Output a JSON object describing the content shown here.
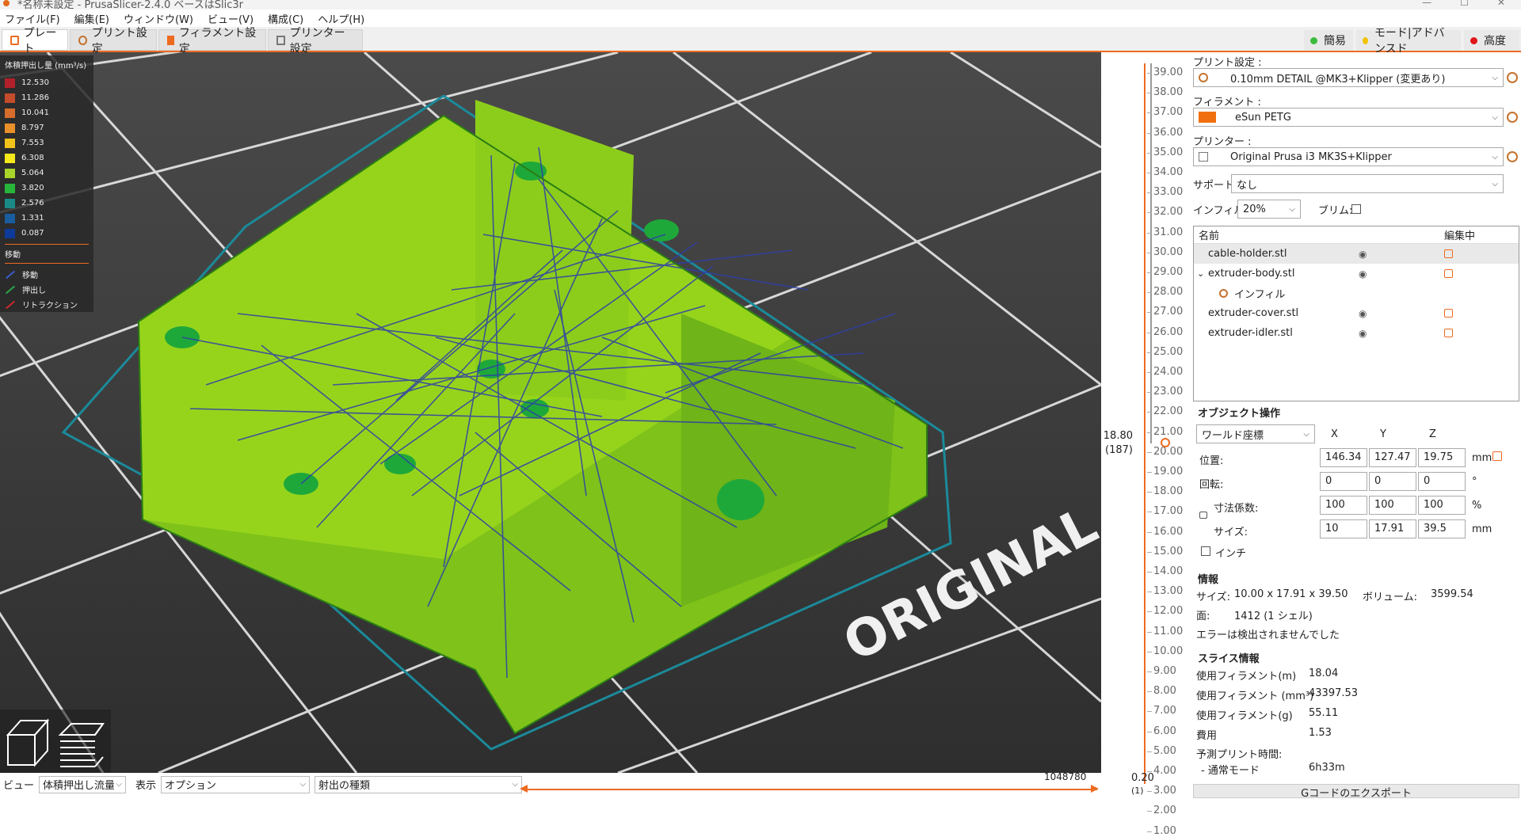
{
  "window": {
    "title": "*名称未設定 - PrusaSlicer-2.4.0 ベースはSlic3r",
    "minimize": "—",
    "maximize": "☐",
    "close": "✕"
  },
  "menu": [
    "ファイル(F)",
    "編集(E)",
    "ウィンドウ(W)",
    "ビュー(V)",
    "構成(C)",
    "ヘルプ(H)"
  ],
  "tabs": [
    {
      "label": "プレート",
      "active": true
    },
    {
      "label": "プリント設定",
      "active": false
    },
    {
      "label": "フィラメント設定",
      "active": false
    },
    {
      "label": "プリンター設定",
      "active": false
    }
  ],
  "modes": [
    {
      "label": "簡易",
      "color": "#3dbb3d"
    },
    {
      "label": "モード|アドバンスド",
      "color": "#f2c300"
    },
    {
      "label": "高度",
      "color": "#e0151b"
    }
  ],
  "legend": {
    "title": "体積押出し量 (mm³/s)",
    "entries": [
      {
        "value": "12.530",
        "color": "#b2202b"
      },
      {
        "value": "11.286",
        "color": "#c44b2c"
      },
      {
        "value": "10.041",
        "color": "#d66d2c"
      },
      {
        "value": "8.797",
        "color": "#e9902b"
      },
      {
        "value": "7.553",
        "color": "#f2c21c"
      },
      {
        "value": "6.308",
        "color": "#f7e81c"
      },
      {
        "value": "5.064",
        "color": "#a8d52a"
      },
      {
        "value": "3.820",
        "color": "#27b53a"
      },
      {
        "value": "2.576",
        "color": "#1b8a86"
      },
      {
        "value": "1.331",
        "color": "#1a5d9e"
      },
      {
        "value": "0.087",
        "color": "#0e3a99"
      }
    ],
    "moves_title": "移動",
    "moves": [
      {
        "label": "移動",
        "color": "#3a5ccc"
      },
      {
        "label": "押出し",
        "color": "#2aa84a"
      },
      {
        "label": "リトラクション",
        "color": "#cc2a2a"
      }
    ]
  },
  "bed_text": "ORIGINAL P",
  "bottom": {
    "view_label": "ビュー",
    "view_value": "体積押出し流量",
    "show_label": "表示",
    "show_value": "オプション",
    "type_value": "射出の種類",
    "h_slider_value": "1048780"
  },
  "vertical_slider": {
    "ticks": [
      "39.00",
      "38.00",
      "37.00",
      "36.00",
      "35.00",
      "34.00",
      "33.00",
      "32.00",
      "31.00",
      "30.00",
      "29.00",
      "28.00",
      "27.00",
      "26.00",
      "25.00",
      "24.00",
      "23.00",
      "22.00",
      "21.00",
      "20.00",
      "19.00",
      "18.00",
      "17.00",
      "16.00",
      "15.00",
      "14.00",
      "13.00",
      "12.00",
      "11.00",
      "10.00",
      "9.00",
      "8.00",
      "7.00",
      "6.00",
      "5.00",
      "4.00",
      "3.00",
      "2.00",
      "1.00"
    ],
    "current_height": "18.80",
    "current_layer": "(187)",
    "bottom_height": "0.20",
    "bottom_layer": "(1)"
  },
  "panel": {
    "print_label": "プリント設定 :",
    "print_value": "0.10mm DETAIL @MK3+Klipper (変更あり)",
    "filament_label": "フィラメント :",
    "filament_value": "eSun PETG",
    "filament_color": "#f07010",
    "printer_label": "プリンター :",
    "printer_value": "Original Prusa i3 MK3S+Klipper",
    "support_label": "サポート:",
    "support_value": "なし",
    "infill_label": "インフィル:",
    "infill_value": "20%",
    "brim_label": "ブリム:",
    "list_col_name": "名前",
    "list_col_edit": "編集中",
    "objects": [
      {
        "name": "cable-holder.stl",
        "selected": true,
        "expander": "",
        "indent": false
      },
      {
        "name": "extruder-body.stl",
        "selected": false,
        "expander": "⌄",
        "indent": false
      },
      {
        "name": "インフィル",
        "selected": false,
        "expander": "",
        "indent": true
      },
      {
        "name": "extruder-cover.stl",
        "selected": false,
        "expander": "",
        "indent": false
      },
      {
        "name": "extruder-idler.stl",
        "selected": false,
        "expander": "",
        "indent": false
      }
    ],
    "eye_glyph": "👁",
    "obj_ops_title": "オブジェクト操作",
    "coord_value": "ワールド座標",
    "axis_x": "X",
    "axis_y": "Y",
    "axis_z": "Z",
    "position_label": "位置:",
    "position": [
      "146.34",
      "127.47",
      "19.75"
    ],
    "position_unit": "mm",
    "rotation_label": "回転:",
    "rotation": [
      "0",
      "0",
      "0"
    ],
    "rotation_unit": "°",
    "scale_label": "寸法係数:",
    "scale": [
      "100",
      "100",
      "100"
    ],
    "scale_unit": "%",
    "size_label": "サイズ:",
    "size": [
      "10",
      "17.91",
      "39.5"
    ],
    "size_unit": "mm",
    "inch_label": "インチ",
    "info_title": "情報",
    "info_size_label": "サイズ:",
    "info_size_value": "10.00 x 17.91 x 39.50",
    "info_volume_label": "ボリューム:",
    "info_volume_value": "3599.54",
    "info_faces_label": "面:",
    "info_faces_value": "1412 (1 シェル)",
    "info_errors": "エラーは検出されませんでした",
    "slice_title": "スライス情報",
    "slice_rows": [
      {
        "label": "使用フィラメント(m)",
        "value": "18.04"
      },
      {
        "label": "使用フィラメント (mm³)",
        "value": "43397.53"
      },
      {
        "label": "使用フィラメント(g)",
        "value": "55.11"
      },
      {
        "label": "費用",
        "value": "1.53"
      }
    ],
    "est_time_label": "予測プリント時間:",
    "normal_mode_label": "- 通常モード",
    "normal_mode_value": "6h33m",
    "export_label": "Gコードのエクスポート"
  }
}
